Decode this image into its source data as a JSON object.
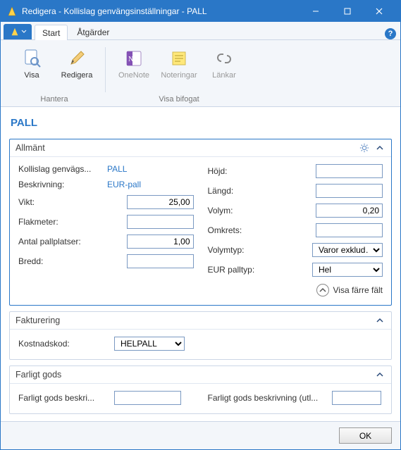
{
  "window": {
    "title": "Redigera - Kollislag genvängsinställningar - PALL"
  },
  "ribbon": {
    "tabs": {
      "start": "Start",
      "atgarder": "Åtgärder"
    },
    "buttons": {
      "visa": "Visa",
      "redigera": "Redigera",
      "onenote": "OneNote",
      "noteringar": "Noteringar",
      "lankar": "Länkar"
    },
    "groups": {
      "hantera": "Hantera",
      "visa_bifogat": "Visa bifogat"
    }
  },
  "content": {
    "heading": "PALL"
  },
  "allmant": {
    "title": "Allmänt",
    "kollislag_label": "Kollislag genvägs...",
    "kollislag_value": "PALL",
    "beskrivning_label": "Beskrivning:",
    "beskrivning_value": "EUR-pall",
    "vikt_label": "Vikt:",
    "vikt_value": "25,00",
    "flakmeter_label": "Flakmeter:",
    "flakmeter_value": "",
    "antal_label": "Antal pallplatser:",
    "antal_value": "1,00",
    "bredd_label": "Bredd:",
    "bredd_value": "",
    "hojd_label": "Höjd:",
    "hojd_value": "",
    "langd_label": "Längd:",
    "langd_value": "",
    "volym_label": "Volym:",
    "volym_value": "0,20",
    "omkrets_label": "Omkrets:",
    "omkrets_value": "",
    "volymtyp_label": "Volymtyp:",
    "volymtyp_value": "Varor exklud…",
    "eurpalltyp_label": "EUR palltyp:",
    "eurpalltyp_value": "Hel",
    "show_fewer": "Visa färre fält"
  },
  "fakturering": {
    "title": "Fakturering",
    "kostnadskod_label": "Kostnadskod:",
    "kostnadskod_value": "HELPALL"
  },
  "farligtgods": {
    "title": "Farligt gods",
    "beskr_sv_label": "Farligt gods beskri...",
    "beskr_sv_value": "",
    "beskr_utl_label": "Farligt gods beskrivning (utl...",
    "beskr_utl_value": ""
  },
  "footer": {
    "ok": "OK"
  }
}
